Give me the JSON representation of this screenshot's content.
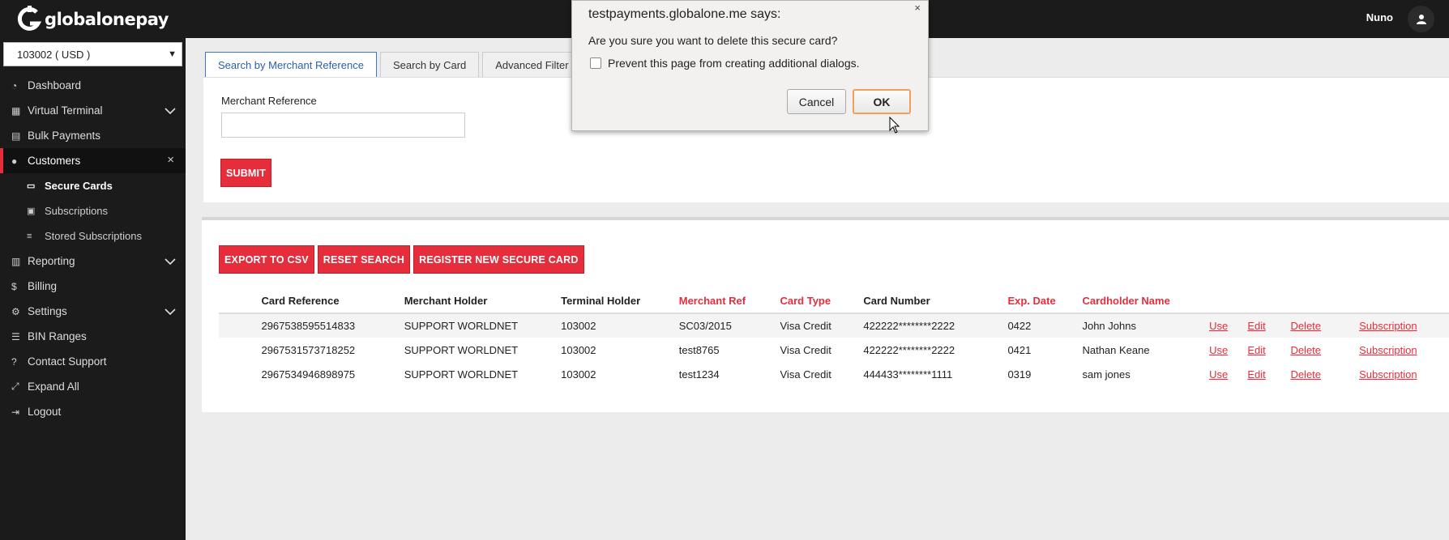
{
  "logo": {
    "mark": "G",
    "text": "globalonepay"
  },
  "account_select": {
    "value": "103002 ( USD )"
  },
  "sidebar": {
    "items": [
      {
        "label": "Dashboard",
        "icon": "dashboard-icon"
      },
      {
        "label": "Virtual Terminal",
        "icon": "calculator-icon"
      },
      {
        "label": "Bulk Payments",
        "icon": "file-icon"
      },
      {
        "label": "Customers",
        "icon": "users-icon"
      },
      {
        "label": "Reporting",
        "icon": "report-icon"
      },
      {
        "label": "Billing",
        "icon": "dollar-icon"
      },
      {
        "label": "Settings",
        "icon": "cogs-icon"
      },
      {
        "label": "BIN Ranges",
        "icon": "list-icon"
      },
      {
        "label": "Contact Support",
        "icon": "help-icon"
      },
      {
        "label": "Expand All",
        "icon": "expand-icon"
      },
      {
        "label": "Logout",
        "icon": "logout-icon"
      }
    ],
    "subitems": [
      {
        "label": "Secure Cards",
        "icon": "credit-card-icon"
      },
      {
        "label": "Subscriptions",
        "icon": "id-card-icon"
      },
      {
        "label": "Stored Subscriptions",
        "icon": "database-icon"
      }
    ]
  },
  "topbar": {
    "user": "Nuno"
  },
  "search": {
    "tabs": [
      "Search by Merchant Reference",
      "Search by Card",
      "Advanced Filter"
    ],
    "field_label": "Merchant Reference",
    "field_value": "",
    "submit": "SUBMIT"
  },
  "results": {
    "actions": [
      "EXPORT TO CSV",
      "RESET SEARCH",
      "REGISTER NEW SECURE CARD"
    ],
    "columns": [
      "Card Reference",
      "Merchant Holder",
      "Terminal Holder",
      "Merchant Ref",
      "Card Type",
      "Card Number",
      "Exp. Date",
      "Cardholder Name"
    ],
    "row_links": [
      "Use",
      "Edit",
      "Delete",
      "Subscription"
    ],
    "rows": [
      [
        "2967538595514833",
        "SUPPORT WORLDNET",
        "103002",
        "SC03/2015",
        "Visa Credit",
        "422222********2222",
        "0422",
        "John Johns"
      ],
      [
        "2967531573718252",
        "SUPPORT WORLDNET",
        "103002",
        "test8765",
        "Visa Credit",
        "422222********2222",
        "0421",
        "Nathan Keane"
      ],
      [
        "2967534946898975",
        "SUPPORT WORLDNET",
        "103002",
        "test1234",
        "Visa Credit",
        "444433********1111",
        "0319",
        "sam jones"
      ]
    ]
  },
  "dialog": {
    "title": "testpayments.globalone.me says:",
    "message": "Are you sure you want to delete this secure card?",
    "checkbox_label": "Prevent this page from creating additional dialogs.",
    "cancel": "Cancel",
    "ok": "OK",
    "close": "×"
  },
  "colors": {
    "accent": "#e62d3c",
    "sidebar_bg": "#1b1b1b",
    "tab_active": "#3b78c4"
  }
}
